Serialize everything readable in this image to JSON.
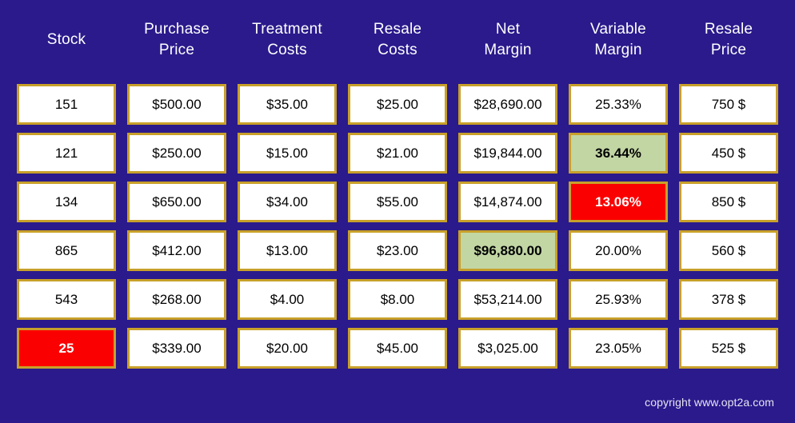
{
  "table": {
    "headers": [
      "Stock",
      "Purchase\nPrice",
      "Treatment\nCosts",
      "Resale\nCosts",
      "Net\nMargin",
      "Variable\nMargin",
      "Resale\nPrice"
    ],
    "rows": [
      [
        {
          "value": "151",
          "style": "normal"
        },
        {
          "value": "$500.00",
          "style": "normal"
        },
        {
          "value": "$35.00",
          "style": "normal"
        },
        {
          "value": "$25.00",
          "style": "normal"
        },
        {
          "value": "$28,690.00",
          "style": "normal"
        },
        {
          "value": "25.33%",
          "style": "normal"
        },
        {
          "value": "750 $",
          "style": "normal"
        }
      ],
      [
        {
          "value": "121",
          "style": "normal"
        },
        {
          "value": "$250.00",
          "style": "normal"
        },
        {
          "value": "$15.00",
          "style": "normal"
        },
        {
          "value": "$21.00",
          "style": "normal"
        },
        {
          "value": "$19,844.00",
          "style": "normal"
        },
        {
          "value": "36.44%",
          "style": "green"
        },
        {
          "value": "450 $",
          "style": "normal"
        }
      ],
      [
        {
          "value": "134",
          "style": "normal"
        },
        {
          "value": "$650.00",
          "style": "normal"
        },
        {
          "value": "$34.00",
          "style": "normal"
        },
        {
          "value": "$55.00",
          "style": "normal"
        },
        {
          "value": "$14,874.00",
          "style": "normal"
        },
        {
          "value": "13.06%",
          "style": "red"
        },
        {
          "value": "850 $",
          "style": "normal"
        }
      ],
      [
        {
          "value": "865",
          "style": "normal"
        },
        {
          "value": "$412.00",
          "style": "normal"
        },
        {
          "value": "$13.00",
          "style": "normal"
        },
        {
          "value": "$23.00",
          "style": "normal"
        },
        {
          "value": "$96,880.00",
          "style": "green"
        },
        {
          "value": "20.00%",
          "style": "normal"
        },
        {
          "value": "560 $",
          "style": "normal"
        }
      ],
      [
        {
          "value": "543",
          "style": "normal"
        },
        {
          "value": "$268.00",
          "style": "normal"
        },
        {
          "value": "$4.00",
          "style": "normal"
        },
        {
          "value": "$8.00",
          "style": "normal"
        },
        {
          "value": "$53,214.00",
          "style": "normal"
        },
        {
          "value": "25.93%",
          "style": "normal"
        },
        {
          "value": "378 $",
          "style": "normal"
        }
      ],
      [
        {
          "value": "25",
          "style": "red"
        },
        {
          "value": "$339.00",
          "style": "normal"
        },
        {
          "value": "$20.00",
          "style": "normal"
        },
        {
          "value": "$45.00",
          "style": "normal"
        },
        {
          "value": "$3,025.00",
          "style": "normal"
        },
        {
          "value": "23.05%",
          "style": "normal"
        },
        {
          "value": "525 $",
          "style": "normal"
        }
      ]
    ]
  },
  "footer": {
    "copyright": "copyright www.opt2a.com"
  },
  "colors": {
    "background": "#2a1a8c",
    "cell_border": "#c8a02a",
    "cell_fill": "#ffffff",
    "highlight_good": "#c2d6a4",
    "highlight_bad": "#fb0000",
    "header_text": "#ffffff"
  }
}
